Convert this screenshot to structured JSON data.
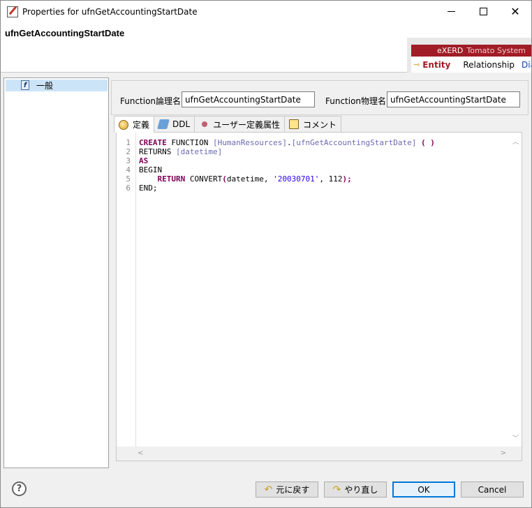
{
  "window": {
    "title": "Properties for ufnGetAccountingStartDate",
    "app_icon": "properties-icon"
  },
  "header": {
    "entity_title": "ufnGetAccountingStartDate",
    "brand": {
      "product": "eXERD",
      "company": "Tomato System",
      "tabs": [
        "Entity",
        "Relationship",
        "Diag"
      ]
    }
  },
  "tree": {
    "items": [
      {
        "label": "一般",
        "icon": "function-icon",
        "selected": true
      }
    ]
  },
  "fields": {
    "logical_label": "Function論理名",
    "logical_value": "ufnGetAccountingStartDate",
    "physical_label": "Function物理名",
    "physical_value": "ufnGetAccountingStartDate"
  },
  "tabs": [
    {
      "label": "定義",
      "icon": "definition-icon",
      "active": true
    },
    {
      "label": "DDL",
      "icon": "ddl-icon",
      "active": false
    },
    {
      "label": "ユーザー定義属性",
      "icon": "user-defined-icon",
      "active": false
    },
    {
      "label": "コメント",
      "icon": "comment-icon",
      "active": false
    }
  ],
  "editor": {
    "line_numbers": [
      "1",
      "2",
      "3",
      "4",
      "5",
      "6"
    ],
    "lines": [
      [
        {
          "t": "CREATE",
          "c": "kw"
        },
        {
          "t": " FUNCTION ",
          "c": "plain"
        },
        {
          "t": "[HumanResources]",
          "c": "id"
        },
        {
          "t": ".",
          "c": "plain"
        },
        {
          "t": "[ufnGetAccountingStartDate]",
          "c": "id"
        },
        {
          "t": " ( )",
          "c": "kw"
        }
      ],
      [
        {
          "t": "RETURNS ",
          "c": "plain"
        },
        {
          "t": "[datetime]",
          "c": "id"
        }
      ],
      [
        {
          "t": "AS",
          "c": "kw"
        }
      ],
      [
        {
          "t": "BEGIN",
          "c": "plain"
        }
      ],
      [
        {
          "t": "    ",
          "c": "plain"
        },
        {
          "t": "RETURN",
          "c": "kw"
        },
        {
          "t": " CONVERT",
          "c": "plain"
        },
        {
          "t": "(",
          "c": "kw"
        },
        {
          "t": "datetime, ",
          "c": "plain"
        },
        {
          "t": "'20030701'",
          "c": "str"
        },
        {
          "t": ", 112",
          "c": "plain"
        },
        {
          "t": ");",
          "c": "kw"
        }
      ],
      [
        {
          "t": "END;",
          "c": "plain"
        }
      ]
    ]
  },
  "buttons": {
    "undo": "元に戻す",
    "redo": "やり直し",
    "ok": "OK",
    "cancel": "Cancel",
    "help": "?"
  }
}
